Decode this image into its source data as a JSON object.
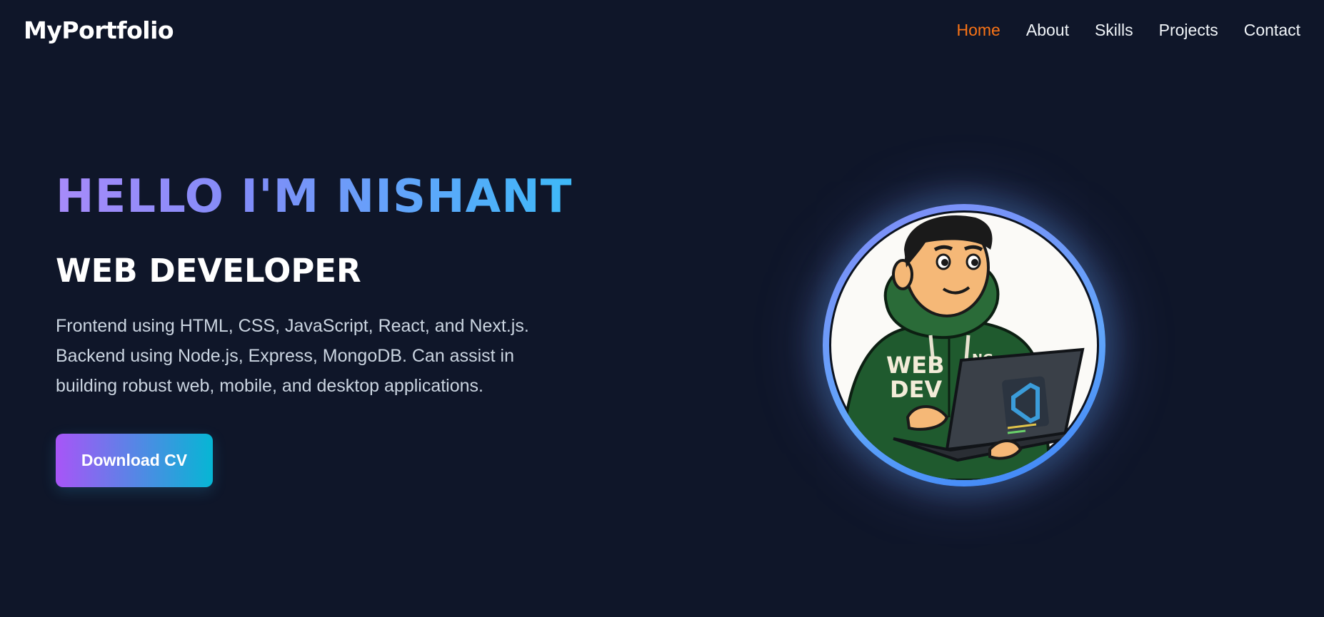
{
  "navbar": {
    "logo": "MyPortfolio",
    "links": [
      {
        "label": "Home",
        "active": true
      },
      {
        "label": "About",
        "active": false
      },
      {
        "label": "Skills",
        "active": false
      },
      {
        "label": "Projects",
        "active": false
      },
      {
        "label": "Contact",
        "active": false
      }
    ]
  },
  "hero": {
    "greeting": "HELLO I'M NISHANT",
    "role": "WEB DEVELOPER",
    "description": "Frontend using HTML, CSS, JavaScript, React, and Next.js. Backend using Node.js, Express, MongoDB. Can assist in building robust web, mobile, and desktop applications.",
    "cta_label": "Download CV"
  },
  "avatar": {
    "hoodie_text_line1": "WEB",
    "hoodie_text_line2": "DEV",
    "hoodie_initials": "NG"
  },
  "colors": {
    "background": "#0f1629",
    "active_nav": "#f97316",
    "gradient_start": "#a78bfa",
    "gradient_end": "#38bdf8",
    "button_start": "#a855f7",
    "button_end": "#06b6d4",
    "hoodie": "#1f5a2e"
  }
}
